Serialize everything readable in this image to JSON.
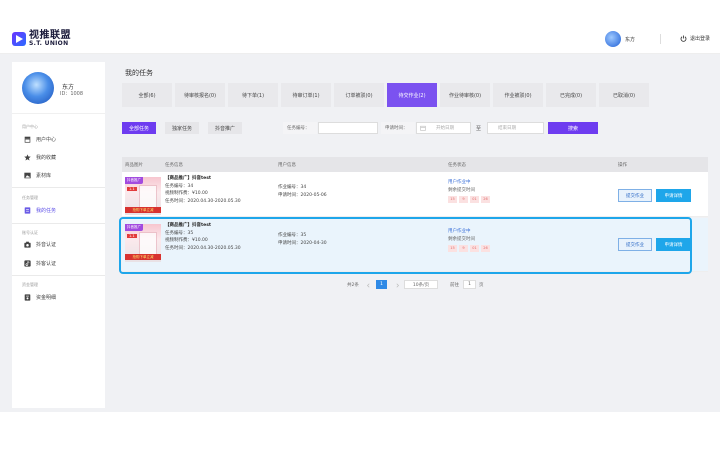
{
  "brand": {
    "name_cn": "视推联盟",
    "name_en": "S.T. UNION"
  },
  "header": {
    "username": "东方",
    "logout": "退出登录"
  },
  "sidebar": {
    "username": "东方",
    "user_id": "ID：1008",
    "groups": [
      {
        "title": "用户中心",
        "items": [
          {
            "label": "用户中心",
            "icon": "store-icon"
          },
          {
            "label": "我的收藏",
            "icon": "star-icon"
          },
          {
            "label": "素材库",
            "icon": "image-icon"
          }
        ]
      },
      {
        "title": "任务管理",
        "items": [
          {
            "label": "我的任务",
            "icon": "task-icon",
            "active": true
          }
        ]
      },
      {
        "title": "账号认证",
        "items": [
          {
            "label": "抖音认证",
            "icon": "camera-icon"
          },
          {
            "label": "抖客认证",
            "icon": "music-icon"
          }
        ]
      },
      {
        "title": "资金管理",
        "items": [
          {
            "label": "资金明细",
            "icon": "wallet-icon"
          }
        ]
      }
    ]
  },
  "main": {
    "title": "我的任务",
    "tabs": [
      "全部(6)",
      "待审核报名(0)",
      "待下单(1)",
      "待审订单(1)",
      "订单被驳(0)",
      "待交作业(2)",
      "作业待审核(0)",
      "作业被驳(0)",
      "已完成(0)",
      "已取消(0)"
    ],
    "active_tab": 5
  },
  "filters": {
    "type_buttons": [
      "全部任务",
      "独家任务",
      "抖音推广"
    ],
    "task_no_label": "任务编号：",
    "task_no_placeholder": "",
    "apply_time_label": "申请时间：",
    "start_placeholder": "开始日期",
    "to_label": "至",
    "end_placeholder": "结束日期",
    "search": "搜索"
  },
  "table": {
    "headers": [
      "商品图片",
      "任务信息",
      "用户信息",
      "任务状态",
      "操作"
    ],
    "rows": [
      {
        "thumb_tag": "抖音推广",
        "thumb_price": "1.1",
        "thumb_banner": "抢购下单立减",
        "task_title": "【商品推广】抖音test",
        "task_no": "任务编号：34",
        "fee": "视频制作费：¥10.00",
        "time": "任务时间：2020.04.30-2020.05.30",
        "homework_no": "作业编号：34",
        "apply_time": "申请时间：2020-05-06",
        "status": "用户作业中",
        "status_sub": "剩余提交时间",
        "countdown": [
          "15",
          "9",
          "01",
          "26"
        ],
        "selected": false
      },
      {
        "thumb_tag": "抖音推广",
        "thumb_price": "1.1",
        "thumb_banner": "抢购下单立减",
        "task_title": "【商品推广】抖音test",
        "task_no": "任务编号：35",
        "fee": "视频制作费：¥10.00",
        "time": "任务时间：2020.04.30-2020.05.30",
        "homework_no": "作业编号：35",
        "apply_time": "申请时间：2020-04-30",
        "status": "用户作业中",
        "status_sub": "剩余提交时间",
        "countdown": [
          "15",
          "9",
          "01",
          "26"
        ],
        "selected": true
      }
    ],
    "actions": {
      "submit": "提交作业",
      "detail": "申请详情"
    }
  },
  "pager": {
    "total": "共2条",
    "current": "1",
    "page_size": "10条/页",
    "goto": "前往",
    "goto_value": "1",
    "unit": "页"
  },
  "colors": {
    "accent": "#6e3cf0",
    "highlight": "#1ea6ea"
  }
}
